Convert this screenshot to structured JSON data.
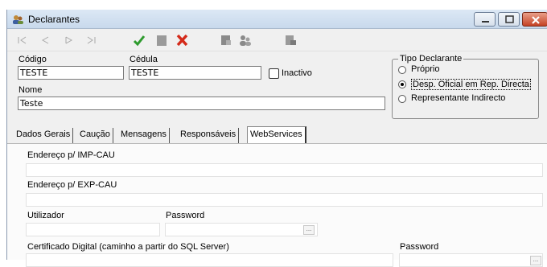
{
  "window": {
    "title": "Declarantes"
  },
  "icons": {
    "title": "declarantes-app-icon",
    "first": "nav-first-icon",
    "prev": "nav-prev-icon",
    "next": "nav-next-icon",
    "last": "nav-last-icon",
    "confirm": "confirm-check-icon",
    "save": "save-icon",
    "cancel": "cancel-x-icon",
    "print": "print-icon",
    "users": "users-icon",
    "export": "export-icon"
  },
  "header": {
    "codigo_label": "Código",
    "codigo_value": "TESTE",
    "cedula_label": "Cédula",
    "cedula_value": "TESTE",
    "inactivo_label": "Inactivo",
    "nome_label": "Nome",
    "nome_value": "Teste"
  },
  "tipo_declarante": {
    "title": "Tipo Declarante",
    "options": [
      {
        "label": "Próprio",
        "selected": false
      },
      {
        "label": "Desp. Oficial em Rep. Directa",
        "selected": true
      },
      {
        "label": "Representante Indirecto",
        "selected": false
      }
    ]
  },
  "tabs": [
    {
      "label": "Dados Gerais",
      "active": false
    },
    {
      "label": "Caução",
      "active": false
    },
    {
      "label": "Mensagens",
      "active": false
    },
    {
      "label": "Responsáveis",
      "active": false
    },
    {
      "label": "WebServices",
      "active": true
    }
  ],
  "webservices": {
    "imp_label": "Endereço p/ IMP-CAU",
    "imp_value": "",
    "exp_label": "Endereço p/ EXP-CAU",
    "exp_value": "",
    "utilizador_label": "Utilizador",
    "utilizador_value": "",
    "password_label": "Password",
    "password_value": "",
    "cert_label": "Certificado Digital (caminho a partir do SQL Server)",
    "cert_value": "",
    "cert_password_label": "Password",
    "cert_password_value": "",
    "ellipsis": "..."
  },
  "colors": {
    "confirm": "#2e9b2e",
    "cancel": "#d42a1a",
    "disabled": "#9a9a9a"
  }
}
